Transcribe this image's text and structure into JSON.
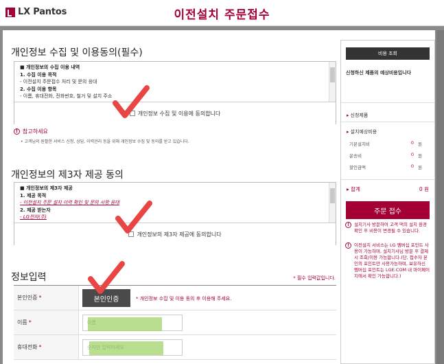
{
  "header": {
    "logo_text": "LX Pantos",
    "title": "이전설치 주문접수"
  },
  "consent1": {
    "title": "개인정보 수집 및 이용동의(필수)",
    "lines": [
      "■ 개인정보의 수집 이용 내역",
      "1. 수집 이용 목적",
      "- 이전설치 주문접수 처리 및 문의 응대",
      "2. 수집 이용 항목",
      "- 이름, 휴대전화, 전화번호, 철거 및 설치 주소"
    ],
    "agree_label": "개인정보 수집 및 이용에 동의합니다"
  },
  "notice": {
    "title": "참고하세요",
    "text": "• 고객님의 원활한 서비스 신청, 상담, 이력관리 등을 위해 개인정보 수집 및 동의를 받고 있습니다."
  },
  "consent2": {
    "title": "개인정보의 제3자 제공 동의",
    "lines": [
      "■ 개인정보의 제3자 제공",
      "1. 제공 목적",
      "- 이전설치 주문 설치 이력 확인 및 문의 사항 응대",
      "2. 제공 받는자",
      "- LG전자(주)"
    ],
    "agree_label": "개인정보의 제3자 제공에 동의합니다"
  },
  "form": {
    "title": "정보입력",
    "required_note": "* 필수 입력값입니다.",
    "auth_label": "본인인증",
    "auth_button": "본인인증",
    "auth_note": "* 개인정보 수집 및 이용 동의 후 이용해 주세요.",
    "name_label": "이름",
    "name_placeholder": "이름",
    "phone_label": "휴대전화",
    "phone_placeholder": "숫자만 입력하세요"
  },
  "sidebar": {
    "cost_button": "비용 조회",
    "desc": "신청하신 제품의 예상비용입니다",
    "product_head": "신청제품",
    "cost_head": "설치예상비용",
    "items": [
      {
        "label": "기본설치비",
        "value": "0",
        "unit": "원"
      },
      {
        "label": "운송비",
        "value": "0",
        "unit": "원"
      },
      {
        "label": "할인금액",
        "value": "0",
        "unit": "원"
      }
    ],
    "total_label": "합계",
    "total_value": "0",
    "total_unit": "원",
    "order_button": "주문 접수",
    "note1": "설치기사 방문하여 고객 댁의 설치 환경 확인 후 비용이 변경될 수 있습니다.",
    "note2": "이전설치 서비스는 LG 멤버십 포인트 사용이 가능하며, 설치기사님 방문 후 결제 시 조회/이용 가능합니다.(단, 접수자 본인의 포인트만 사용가능하며, 보유하신 멤버십 포인트는 LGE.COM 내 마이페이지에서 확인 가능합니다.)"
  },
  "colors": {
    "brand": "#a50034",
    "check_mark": "#e84545",
    "highlight": "#8cc846"
  }
}
